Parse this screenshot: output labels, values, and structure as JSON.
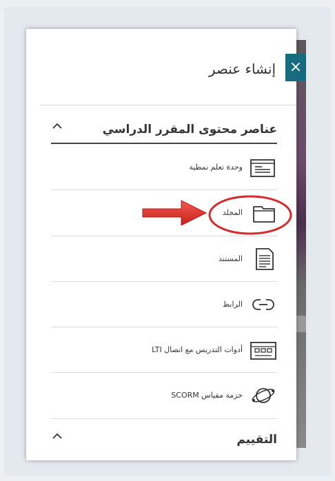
{
  "panel": {
    "title": "إنشاء عنصر",
    "close_symbol": "×"
  },
  "sections": [
    {
      "label": "عناصر محتوى المقرر الدراسي",
      "chevron": "^"
    },
    {
      "label": "التقييم",
      "chevron": "^"
    }
  ],
  "items": [
    {
      "label": "وحدة تعلم نمطية",
      "icon": "module-icon"
    },
    {
      "label": "المجلد",
      "icon": "folder-icon"
    },
    {
      "label": "المستند",
      "icon": "document-icon"
    },
    {
      "label": "الرابط",
      "icon": "link-icon"
    },
    {
      "label": "أدوات التدريس مع اتصال LTI",
      "icon": "lti-tool-icon"
    },
    {
      "label": "حزمة مقياس SCORM",
      "icon": "scorm-package-icon"
    }
  ],
  "annotation": {
    "arrow_color": "#e0302b",
    "highlight_color": "#d42a2a",
    "highlighted_item": "المجلد"
  }
}
